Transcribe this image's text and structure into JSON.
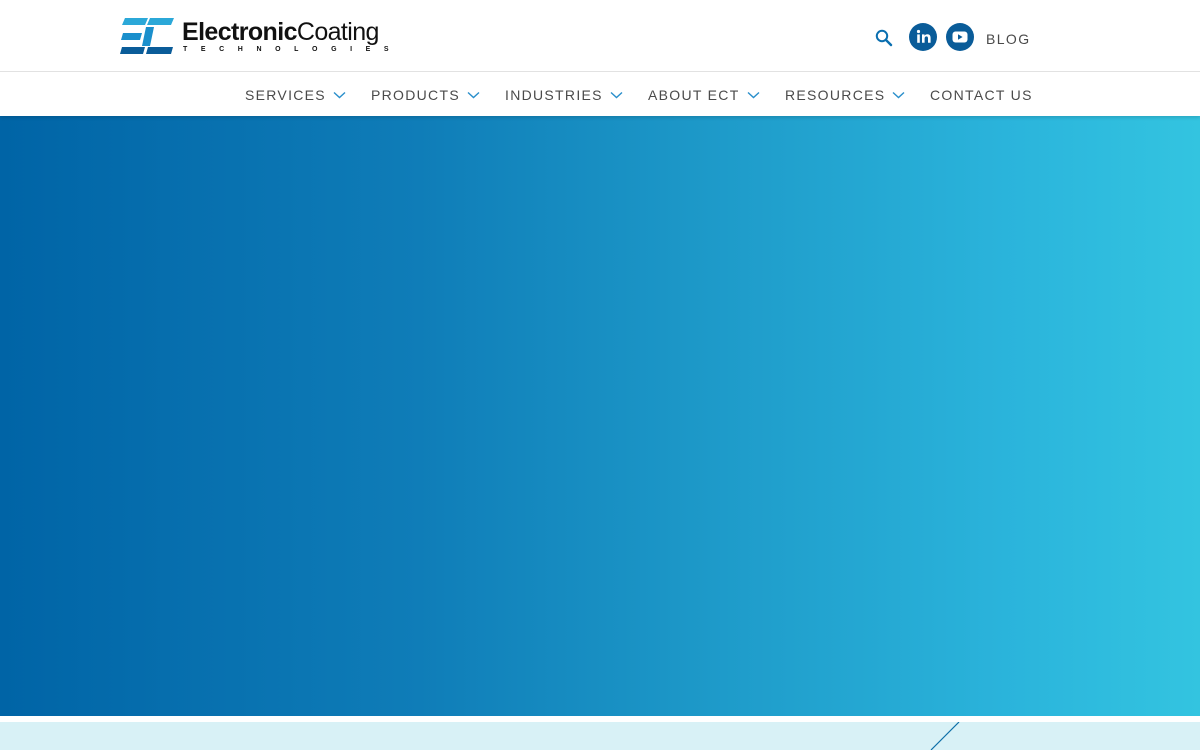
{
  "brand": {
    "name_bold": "Electronic",
    "name_light": "Coating",
    "tagline": "TECHNOLOGIES",
    "colors": {
      "logo_dark": "#0a5c99",
      "logo_light": "#2ba8d8"
    }
  },
  "header": {
    "icons": {
      "search": "search-icon",
      "linkedin": "linkedin-icon",
      "youtube": "youtube-icon"
    },
    "blog_label": "BLOG"
  },
  "nav": {
    "items": [
      {
        "label": "SERVICES",
        "has_dropdown": true
      },
      {
        "label": "PRODUCTS",
        "has_dropdown": true
      },
      {
        "label": "INDUSTRIES",
        "has_dropdown": true
      },
      {
        "label": "ABOUT ECT",
        "has_dropdown": true
      },
      {
        "label": "RESOURCES",
        "has_dropdown": true
      },
      {
        "label": "CONTACT US",
        "has_dropdown": false
      }
    ]
  },
  "hero": {
    "gradient": {
      "start": "#0064a6",
      "end": "#33c4e0"
    }
  },
  "band": {
    "color": "#d8f1f6",
    "line_color": "#0d6fa8"
  }
}
